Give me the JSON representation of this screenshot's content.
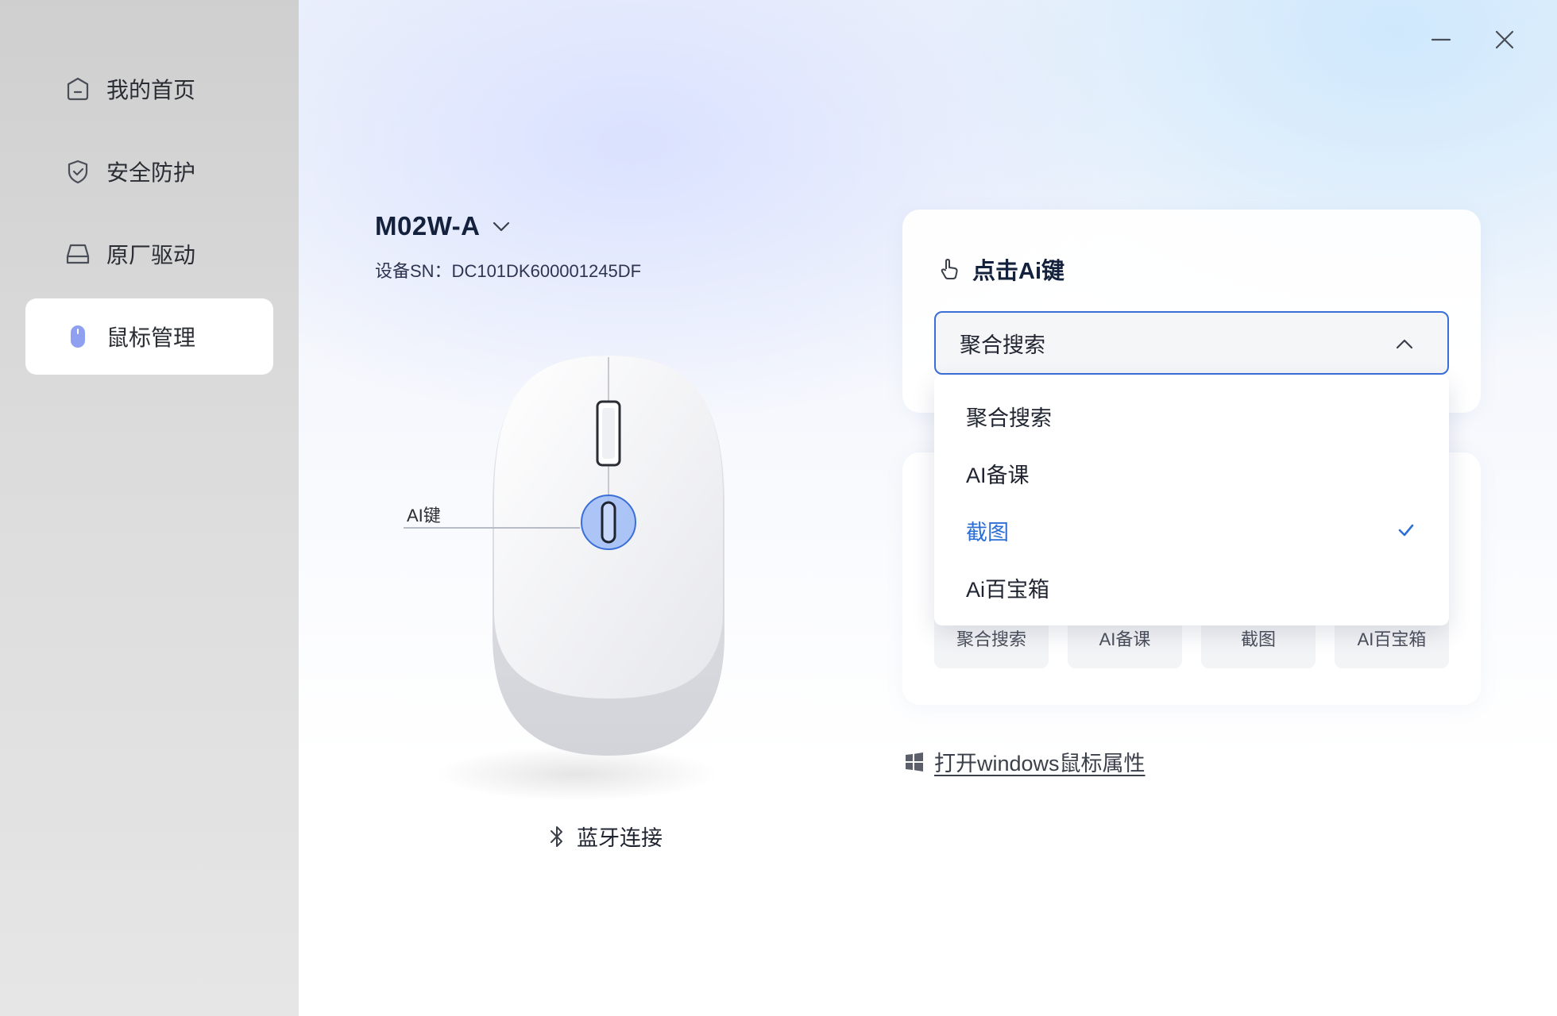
{
  "sidebar": {
    "items": [
      {
        "label": "我的首页",
        "icon": "home-icon"
      },
      {
        "label": "安全防护",
        "icon": "shield-icon"
      },
      {
        "label": "原厂驱动",
        "icon": "drive-icon"
      },
      {
        "label": "鼠标管理",
        "icon": "mouse-icon",
        "active": true
      }
    ]
  },
  "window": {
    "minimize_icon": "minimize-icon",
    "close_icon": "close-icon"
  },
  "device": {
    "model": "M02W-A",
    "sn": "设备SN：DC101DK600001245DF",
    "ai_key_label": "AI键",
    "connection": "蓝牙连接"
  },
  "ai_click_card": {
    "title": "点击Ai键",
    "selected_value": "聚合搜索"
  },
  "dropdown": {
    "options": [
      {
        "label": "聚合搜索"
      },
      {
        "label": "AI备课"
      },
      {
        "label": "截图",
        "selected": true
      },
      {
        "label": "Ai百宝箱"
      }
    ]
  },
  "second_card": {
    "chips": [
      "聚合搜索",
      "AI备课",
      "截图",
      "AI百宝箱"
    ]
  },
  "windows_link": {
    "label": "打开windows鼠标属性"
  },
  "colors": {
    "accent": "#3a6fd8",
    "selected": "#2e6fd6",
    "ai_key_highlight": "#8fb0f5"
  }
}
